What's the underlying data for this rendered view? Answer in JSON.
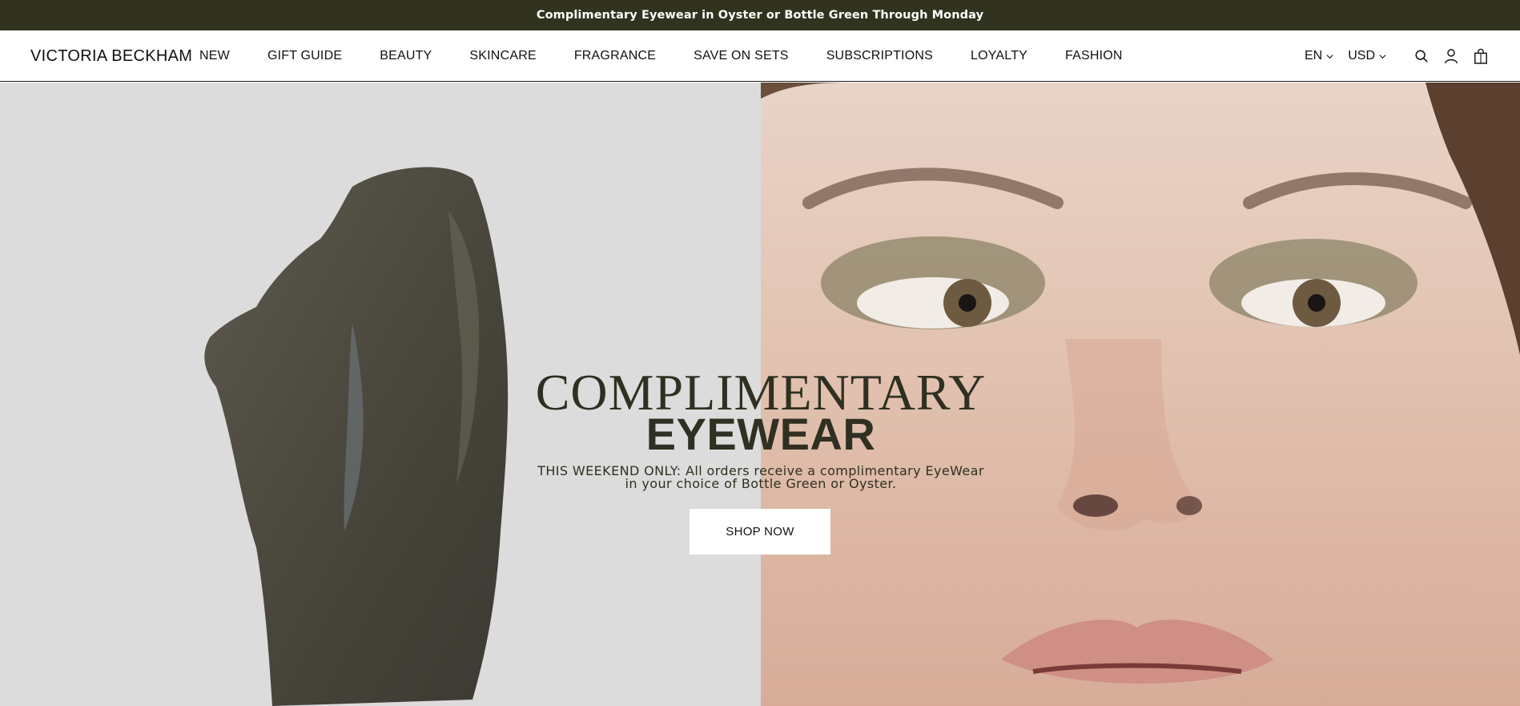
{
  "announcement": {
    "text": "Complimentary Eyewear in Oyster or Bottle Green Through Monday"
  },
  "header": {
    "logo": "VICTORIA BECKHAM",
    "nav": [
      "NEW",
      "GIFT GUIDE",
      "BEAUTY",
      "SKINCARE",
      "FRAGRANCE",
      "SAVE ON SETS",
      "SUBSCRIPTIONS",
      "LOYALTY",
      "FASHION"
    ],
    "language": "EN",
    "currency": "USD",
    "icons": [
      "search-icon",
      "account-icon",
      "bag-icon"
    ]
  },
  "hero": {
    "headline_1": "COMPLIMENTARY",
    "headline_2": "EYEWEAR",
    "subtext": "THIS WEEKEND ONLY: All orders receive a complimentary EyeWear\nin your choice of Bottle Green or Oyster.",
    "cta": "SHOP NOW"
  },
  "colors": {
    "announcement_bg": "#32331f",
    "headline": "#2f3021",
    "hero_left_bg": "#dcdcdc"
  }
}
